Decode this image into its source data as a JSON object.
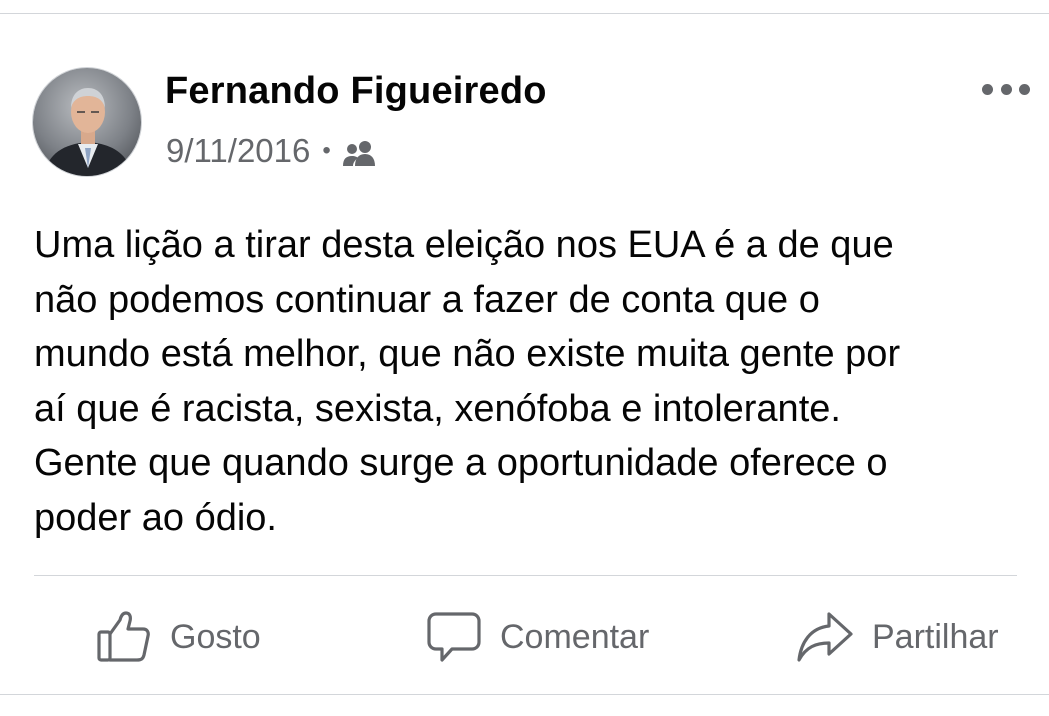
{
  "post": {
    "author": "Fernando Figueiredo",
    "date": "9/11/2016",
    "separator": "•",
    "audience_icon": "friends-icon",
    "more_icon": "more-horizontal-icon",
    "text": "Uma lição a tirar desta eleição nos EUA é a de que\nnão podemos continuar a fazer de conta que o\nmundo está melhor, que não existe muita gente por\naí que é racista, sexista, xenófoba e intolerante.\nGente que quando surge a oportunidade oferece o\npoder ao ódio."
  },
  "actions": {
    "like_label": "Gosto",
    "like_icon": "thumbs-up-icon",
    "comment_label": "Comentar",
    "comment_icon": "speech-bubble-icon",
    "share_label": "Partilhar",
    "share_icon": "share-arrow-icon"
  },
  "colors": {
    "text_primary": "#050505",
    "text_secondary": "#65676b",
    "divider": "#d3d6da",
    "background": "#ffffff"
  }
}
